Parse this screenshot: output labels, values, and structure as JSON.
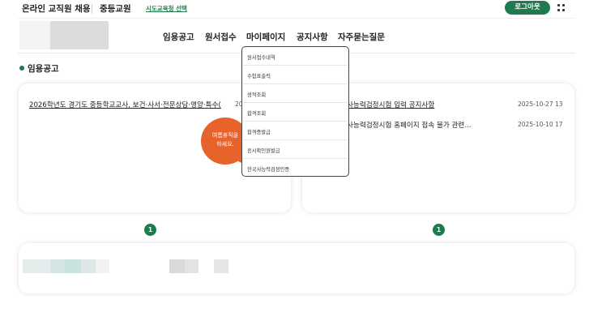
{
  "topbar": {
    "site_title": "온라인 교직원 채용",
    "site_sub": "중등교원",
    "region_link": "시도교육청 선택",
    "logout": "로그아웃"
  },
  "nav": {
    "items": [
      "임용공고",
      "원서접수",
      "마이페이지",
      "공지사항",
      "자주묻는질문"
    ]
  },
  "section": {
    "title": "임용공고"
  },
  "left_card": {
    "notice_title": "2026학년도 경기도 중등학교교사, 보건·사서·전문상담·영양·특수(",
    "notice_date_fragment": "20"
  },
  "right_card": {
    "notices": [
      {
        "title": "사능력검정시험 입력 공지사항",
        "date": "2025-10-27 13"
      },
      {
        "title": "사능력검정시험 홈페이지 접속 불가 관련...",
        "date": "2025-10-10 17"
      }
    ]
  },
  "pagination": {
    "left_page": "1",
    "right_page": "1"
  },
  "dropdown": {
    "items": [
      "원서접수내역",
      "수험표출력",
      "성적조회",
      "합격조회",
      "합격증발급",
      "응시확인원발급",
      "한국사능력검정인증"
    ]
  },
  "bubble": {
    "line1": "여름휴직을",
    "line2": "하세요."
  },
  "colors": {
    "brand_green": "#1f7a4d",
    "bubble_orange": "#e8632c"
  }
}
